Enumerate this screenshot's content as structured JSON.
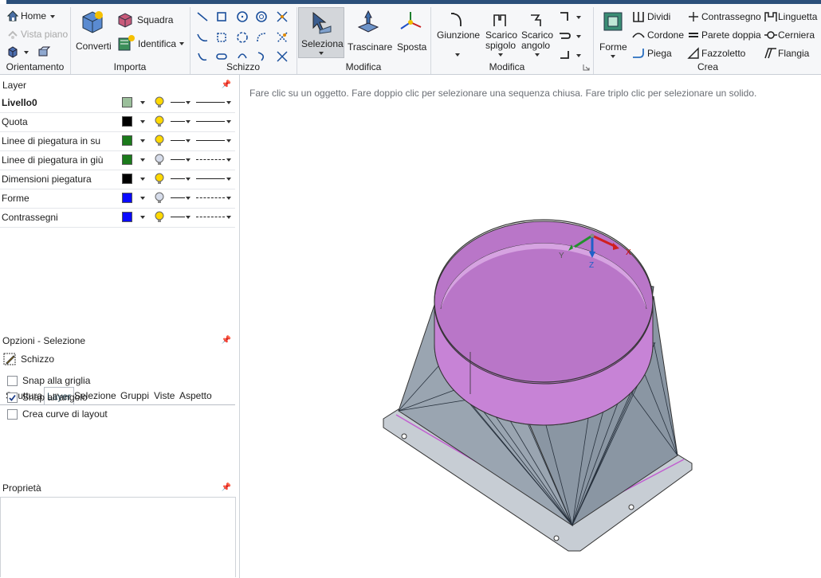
{
  "ribbon": {
    "orientamento": {
      "label": "Orientamento",
      "home": "Home",
      "vista_piano": "Vista piano"
    },
    "importa": {
      "label": "Importa",
      "converti": "Converti",
      "squadra": "Squadra",
      "identifica": "Identifica"
    },
    "schizzo": {
      "label": "Schizzo"
    },
    "modifica1": {
      "label": "Modifica",
      "seleziona": "Seleziona",
      "trascinare": "Trascinare",
      "sposta": "Sposta"
    },
    "modifica2": {
      "label": "Modifica",
      "giunzione": "Giunzione",
      "scarico_spigolo_1": "Scarico",
      "scarico_spigolo_2": "spigolo",
      "scarico_angolo_1": "Scarico",
      "scarico_angolo_2": "angolo"
    },
    "crea": {
      "label": "Crea",
      "forme": "Forme",
      "dividi": "Dividi",
      "cordone": "Cordone",
      "piega": "Piega",
      "contrassegno": "Contrassegno",
      "parete_doppia": "Parete doppia",
      "fazzoletto": "Fazzoletto",
      "linguetta": "Linguetta",
      "cerniera": "Cerniera",
      "flangia": "Flangia"
    }
  },
  "layer_panel": {
    "title": "Layer",
    "layers": [
      {
        "name": "Livello0",
        "color": "#9bbf9b",
        "bulb": "on",
        "dash": false,
        "bold": true
      },
      {
        "name": "Quota",
        "color": "#000000",
        "bulb": "on",
        "dash": false,
        "bold": false
      },
      {
        "name": "Linee di piegatura in su",
        "color": "#1b7a1b",
        "bulb": "on",
        "dash": false,
        "bold": false
      },
      {
        "name": "Linee di piegatura in giù",
        "color": "#1b7a1b",
        "bulb": "off",
        "dash": true,
        "bold": false
      },
      {
        "name": "Dimensioni piegatura",
        "color": "#000000",
        "bulb": "on",
        "dash": false,
        "bold": false
      },
      {
        "name": "Forme",
        "color": "#0a0aff",
        "bulb": "off",
        "dash": true,
        "bold": false
      },
      {
        "name": "Contrassegni",
        "color": "#0a0aff",
        "bulb": "on",
        "dash": true,
        "bold": false
      }
    ]
  },
  "tabs": [
    {
      "label": "Struttura",
      "active": false
    },
    {
      "label": "Layer",
      "active": true
    },
    {
      "label": "Selezione",
      "active": false
    },
    {
      "label": "Gruppi",
      "active": false
    },
    {
      "label": "Viste",
      "active": false
    },
    {
      "label": "Aspetto",
      "active": false
    }
  ],
  "options_panel": {
    "title": "Opzioni - Selezione",
    "mode": "Schizzo",
    "options": [
      {
        "label": "Snap alla griglia",
        "checked": false
      },
      {
        "label": "Snap all'angolo",
        "checked": true
      },
      {
        "label": "Crea curve di layout",
        "checked": false
      }
    ]
  },
  "properties_panel": {
    "title": "Proprietà"
  },
  "viewport": {
    "hint": "Fare clic su un oggetto. Fare doppio clic per selezionare una sequenza chiusa. Fare triplo clic per selezionare un solido.",
    "axes": {
      "x": "X",
      "y": "Y",
      "z": "Z"
    }
  },
  "colors": {
    "accent": "#2b4f7a",
    "part_gray": "#a9b3bf",
    "selected_band": "#c783d6"
  }
}
